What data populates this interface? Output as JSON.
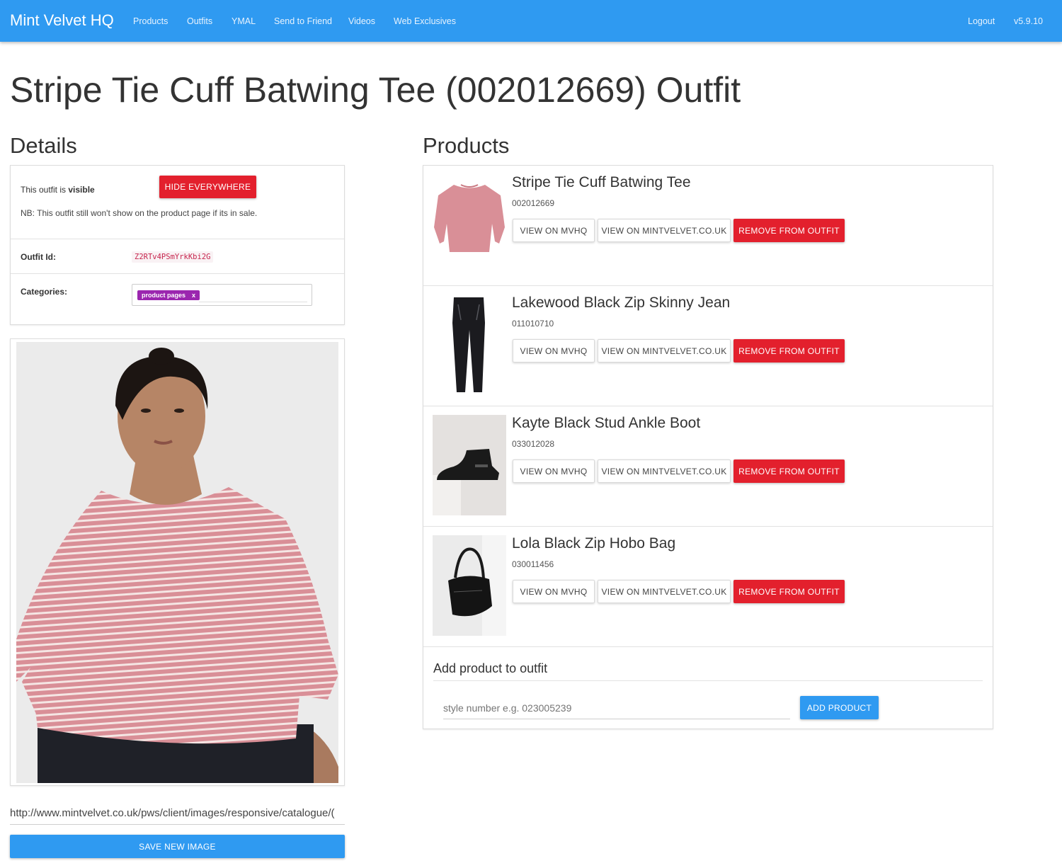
{
  "nav": {
    "brand": "Mint Velvet HQ",
    "links": [
      "Products",
      "Outfits",
      "YMAL",
      "Send to Friend",
      "Videos",
      "Web Exclusives"
    ],
    "logout": "Logout",
    "version": "v5.9.10"
  },
  "page": {
    "title": "Stripe Tie Cuff Batwing Tee (002012669) Outfit"
  },
  "details": {
    "heading": "Details",
    "visibility_prefix": "This outfit is",
    "visibility_state": "visible",
    "hide_button": "HIDE EVERYWHERE",
    "note": "NB: This outfit still won't show on the product page if its in sale.",
    "outfit_id_label": "Outfit Id:",
    "outfit_id": "Z2RTv4PSmYrkKbi2G",
    "categories_label": "Categories:",
    "category_tags": [
      {
        "label": "product pages",
        "remove": "x"
      }
    ],
    "image_url": "http://www.mintvelvet.co.uk/pws/client/images/responsive/catalogue/(",
    "save_image_button": "SAVE NEW IMAGE"
  },
  "products": {
    "heading": "Products",
    "items": [
      {
        "name": "Stripe Tie Cuff Batwing Tee",
        "code": "002012669",
        "thumb": "pink-top"
      },
      {
        "name": "Lakewood Black Zip Skinny Jean",
        "code": "011010710",
        "thumb": "black-jeans"
      },
      {
        "name": "Kayte Black Stud Ankle Boot",
        "code": "033012028",
        "thumb": "ankle-boot"
      },
      {
        "name": "Lola Black Zip Hobo Bag",
        "code": "030011456",
        "thumb": "hobo-bag"
      }
    ],
    "view_mvhq": "VIEW ON MVHQ",
    "view_site": "VIEW ON MINTVELVET.CO.UK",
    "remove": "REMOVE FROM OUTFIT",
    "add_heading": "Add product to outfit",
    "add_placeholder": "style number e.g. 023005239",
    "add_button": "ADD PRODUCT"
  },
  "colors": {
    "primary": "#2f9af1",
    "danger": "#e3202d",
    "tag": "#9b26af"
  }
}
